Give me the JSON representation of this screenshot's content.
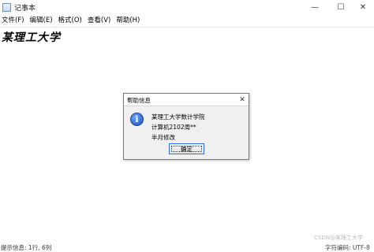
{
  "window": {
    "title": "记事本",
    "controls": {
      "minimize": "—",
      "maximize": "☐",
      "close": "✕"
    }
  },
  "menubar": {
    "items": [
      {
        "label": "文件(F)"
      },
      {
        "label": "编辑(E)"
      },
      {
        "label": "格式(O)"
      },
      {
        "label": "查看(V)"
      },
      {
        "label": "帮助(H)"
      }
    ]
  },
  "editor": {
    "content": "某理工大学"
  },
  "dialog": {
    "title": "帮助信息",
    "close": "✕",
    "icon_glyph": "i",
    "lines": [
      "某理工大学数计学院",
      "计算机2102周**",
      "半月修改"
    ],
    "ok_label": "确定"
  },
  "statusbar": {
    "left": "提示信息: 1行, 6列",
    "right": "字符编码: UTF-8"
  },
  "watermark": "CSDN@某理工大学"
}
